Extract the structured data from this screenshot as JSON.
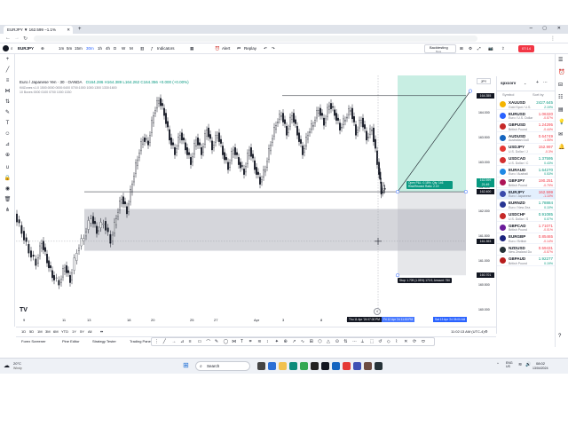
{
  "browser": {
    "tab_title": "EURJPY ▼ 162.599 −1.1%",
    "new_tab": "+",
    "address": ""
  },
  "toolbar": {
    "symbol": "EURJPY",
    "intervals": [
      "1m",
      "5m",
      "15m",
      "30m",
      "1h",
      "4h",
      "D",
      "W",
      "M"
    ],
    "indicators": "Indicators",
    "alert": "Alert",
    "replay": "Replay",
    "backtesting": "Backtesting",
    "backtesting_sub": "Beta",
    "publish": "Publish",
    "price_badge": "07:14"
  },
  "chart": {
    "title": "Euro / Japanese Yen · 30 · OANDA",
    "ohlc": "O164.286 H164.389 L164.262 C164.356 +0.000 (+0.00%)",
    "indicator_line1": "KillZones v1.0 1500:0000 0000:0400 0700:1000 1000:1300 1330:1600",
    "indicator_line2": "10 Boxes 0000 0100 0700 1000 1330",
    "logo": "TV",
    "currency_badge": "JPY",
    "y_ticks": [
      "164.355",
      "164.000",
      "163.500",
      "163.000",
      "162.500",
      "162.000",
      "161.500",
      "161.000",
      "160.500",
      "160.000"
    ],
    "x_ticks": [
      "9",
      "11",
      "13",
      "18",
      "20",
      "25",
      "27",
      "Apr",
      "3",
      "8",
      "10"
    ],
    "price_labels": {
      "top": "164.355",
      "current": "162.599",
      "current_time": "21:49",
      "entry": "162.400",
      "cursor": "161.393",
      "stop": "160.701"
    },
    "position_tool": {
      "target_text": "Open P&L: 0.18%, Qty: 146",
      "target_text2": "Risk/Reward Ratio: 2.19",
      "stop_text": "Stop: 1.709 (1.05%) 170.9, Amount: 750"
    },
    "time_labels": [
      "Thu 11 Apr '24  07:00 PM",
      "Fri 12 Apr '24  11:00 PM",
      "Sat 13 Apr '24  05:00 AM"
    ]
  },
  "bottom": {
    "ranges": [
      "1D",
      "5D",
      "1M",
      "3M",
      "6M",
      "YTD",
      "1Y",
      "5Y",
      "All"
    ],
    "clock": "11:02:13 AM (UTC-4)",
    "tabs": [
      "Forex Screener",
      "Pine Editor",
      "Strategy Tester",
      "Trading Panel"
    ]
  },
  "watchlist": {
    "header": "spxcorv",
    "columns": [
      "Symbol",
      "Sort by"
    ],
    "items": [
      {
        "sym": "XAUUSD",
        "desc": "Gold Spot / U.S.",
        "last": "2427.645",
        "chg": "2.19%",
        "up": true,
        "color": "#f5b400"
      },
      {
        "sym": "EURUSD",
        "desc": "Euro / U.S. Dollar",
        "last": "1.06320",
        "chg": "-0.57%",
        "up": false,
        "color": "#2962ff"
      },
      {
        "sym": "GBPUSD",
        "desc": "British Pound",
        "last": "1.24295",
        "chg": "-0.44%",
        "up": false,
        "color": "#c62828"
      },
      {
        "sym": "AUDUSD",
        "desc": "Australian Doll",
        "last": "0.64749",
        "chg": "-1.05%",
        "up": false,
        "color": "#1565c0"
      },
      {
        "sym": "USDJPY",
        "desc": "U.S. Dollar / J",
        "last": "152.997",
        "chg": "-0.3%",
        "up": false,
        "color": "#e53935"
      },
      {
        "sym": "USDCAD",
        "desc": "U.S. Dollar / C",
        "last": "1.37595",
        "chg": "0.43%",
        "up": true,
        "color": "#d32f2f"
      },
      {
        "sym": "EURAUD",
        "desc": "Euro / Australi",
        "last": "1.64270",
        "chg": "0.53%",
        "up": true,
        "color": "#1e88e5"
      },
      {
        "sym": "GBPJPY",
        "desc": "British Pound",
        "last": "190.251",
        "chg": "-0.79%",
        "up": false,
        "color": "#ad1457"
      },
      {
        "sym": "EURJPY",
        "desc": "Euro / Japanese",
        "last": "162.599",
        "chg": "-1.10%",
        "up": false,
        "color": "#3949ab"
      },
      {
        "sym": "EURNZD",
        "desc": "Euro / New Zea",
        "last": "1.78884",
        "chg": "0.10%",
        "up": true,
        "color": "#283593"
      },
      {
        "sym": "USDCHF",
        "desc": "U.S. Dollar / S",
        "last": "0.91085",
        "chg": "0.07%",
        "up": true,
        "color": "#c62828"
      },
      {
        "sym": "GBPCAD",
        "desc": "British Pound",
        "last": "1.71071",
        "chg": "-0.01%",
        "up": false,
        "color": "#6a1b9a"
      },
      {
        "sym": "EURGBP",
        "desc": "Euro / British",
        "last": "0.85465",
        "chg": "-0.14%",
        "up": false,
        "color": "#1a237e"
      },
      {
        "sym": "NZDUSD",
        "desc": "New Zealand Do",
        "last": "0.59431",
        "chg": "-0.57%",
        "up": false,
        "color": "#263238"
      },
      {
        "sym": "GBPAUD",
        "desc": "British Pound",
        "last": "1.92277",
        "chg": "0.19%",
        "up": true,
        "color": "#b71c1c"
      }
    ]
  },
  "taskbar": {
    "weather_temp": "20°C",
    "weather_desc": "Windy",
    "search": "Search",
    "lang": "ENG\nUS",
    "time": "08:02",
    "date": "13/04/2024"
  },
  "colors": {
    "up": "#089981",
    "down": "#f23645",
    "accent": "#2962ff",
    "target_zone": "#c8eee3",
    "stop_zone": "#e6e7ea"
  }
}
